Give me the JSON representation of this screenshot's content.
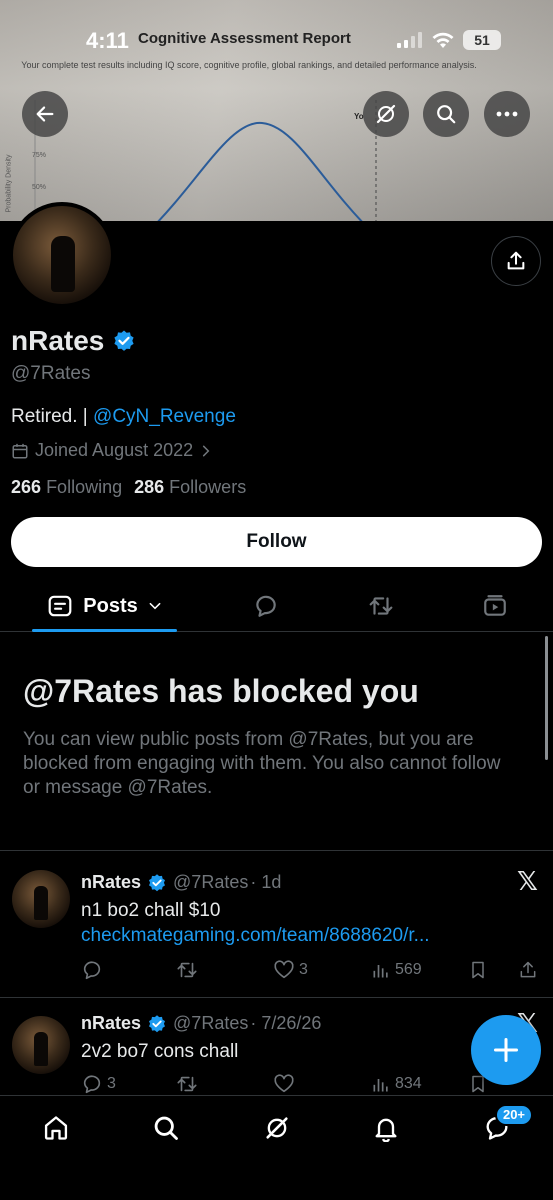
{
  "status_bar": {
    "time": "4:11",
    "battery": "51"
  },
  "banner": {
    "title": "Cognitive Assessment Report",
    "subtitle": "Your complete test results including IQ score, cognitive profile, global rankings, and detailed performance analysis.",
    "axis_label": "Probability Density",
    "tick_75": "75%",
    "tick_50": "50%",
    "marker_text": "Yo"
  },
  "header": {
    "back_icon": "arrow-left-icon",
    "grok_icon": "grok-icon",
    "search_icon": "search-icon",
    "more_icon": "more-icon"
  },
  "profile": {
    "name": "nRates",
    "handle": "@7Rates",
    "bio_text": "Retired. | ",
    "bio_link": "@CyN_Revenge",
    "joined": "Joined August 2022",
    "following_count": "266",
    "following_label": "Following",
    "followers_count": "286",
    "followers_label": "Followers",
    "follow_label": "Follow"
  },
  "tabs": {
    "posts_label": "Posts"
  },
  "blocked": {
    "title": "@7Rates has blocked you",
    "text": "You can view public posts from @7Rates, but you are blocked from engaging with them. You also cannot follow or message @7Rates."
  },
  "posts": [
    {
      "name": "nRates",
      "handle": "@7Rates",
      "time": "· 1d",
      "text": "n1 bo2 chall $10 ",
      "link": "checkmategaming.com/team/8688620/r...",
      "replies": "",
      "reposts": "",
      "likes": "3",
      "views": "569"
    },
    {
      "name": "nRates",
      "handle": "@7Rates",
      "time": "· 7/26/26",
      "text": "2v2 bo7 cons chall",
      "link": "",
      "replies": "3",
      "reposts": "",
      "likes": "",
      "views": "834"
    }
  ],
  "bottom_nav": {
    "messages_badge": "20+"
  },
  "colors": {
    "accent": "#1d9bf0",
    "background": "#000000",
    "muted": "#71767b"
  }
}
